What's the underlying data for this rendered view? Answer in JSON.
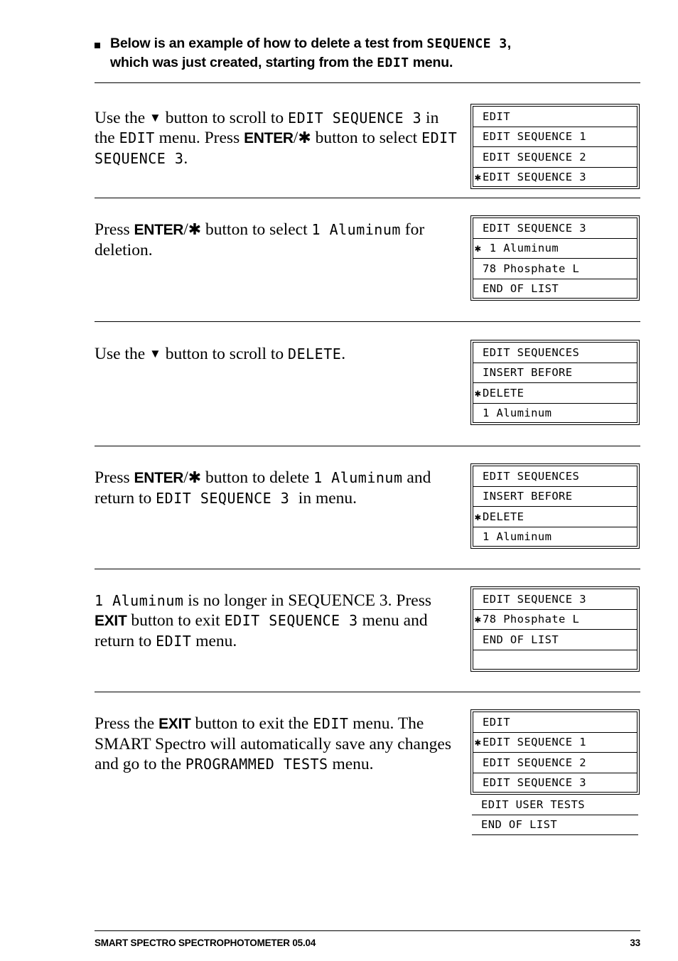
{
  "header": {
    "bullet": "square-bullet",
    "line1_a": "Below is an example of how to delete a test from ",
    "line1_mono": "SEQUENCE 3",
    "line1_b": ",",
    "line2_a": "which was just created, starting from the ",
    "line2_mono": "EDIT",
    "line2_b": " menu."
  },
  "steps": [
    {
      "id": "step-1",
      "text_runs": [
        {
          "t": "Use the ",
          "s": "plain"
        },
        {
          "t": "▼",
          "s": "arrow"
        },
        {
          "t": " button to scroll to ",
          "s": "plain"
        },
        {
          "t": "EDIT SEQUENCE 3",
          "s": "mono"
        },
        {
          "t": " in the ",
          "s": "plain"
        },
        {
          "t": "EDIT",
          "s": "mono"
        },
        {
          "t": " menu. Press ",
          "s": "plain"
        },
        {
          "t": "ENTER",
          "s": "btn"
        },
        {
          "t": "/",
          "s": "plain"
        },
        {
          "t": "✱",
          "s": "ast"
        },
        {
          "t": " button to select ",
          "s": "plain"
        },
        {
          "t": "EDIT SEQUENCE 3",
          "s": "mono"
        },
        {
          "t": ".",
          "s": "plain"
        }
      ],
      "lcd": {
        "rows": [
          {
            "marker": "",
            "label": "EDIT"
          },
          {
            "marker": "",
            "label": "EDIT SEQUENCE 1"
          },
          {
            "marker": "",
            "label": "EDIT SEQUENCE 2"
          },
          {
            "marker": "✱",
            "label": "EDIT SEQUENCE 3"
          }
        ],
        "overflow_rows": []
      }
    },
    {
      "id": "step-2",
      "text_runs": [
        {
          "t": "Press ",
          "s": "plain"
        },
        {
          "t": "ENTER",
          "s": "btn"
        },
        {
          "t": "/",
          "s": "plain"
        },
        {
          "t": "✱",
          "s": "ast"
        },
        {
          "t": " button to select ",
          "s": "plain"
        },
        {
          "t": "1 Aluminum",
          "s": "mono"
        },
        {
          "t": " for deletion.",
          "s": "plain"
        }
      ],
      "lcd": {
        "rows": [
          {
            "marker": "",
            "label": "EDIT SEQUENCE 3"
          },
          {
            "marker": "✱",
            "label": " 1 Aluminum"
          },
          {
            "marker": "",
            "label": "78 Phosphate L"
          },
          {
            "marker": "",
            "label": "END OF LIST"
          }
        ],
        "overflow_rows": []
      }
    },
    {
      "id": "step-3",
      "text_runs": [
        {
          "t": "Use the ",
          "s": "plain"
        },
        {
          "t": "▼",
          "s": "arrow"
        },
        {
          "t": " button to scroll to ",
          "s": "plain"
        },
        {
          "t": "DELETE",
          "s": "mono"
        },
        {
          "t": ".",
          "s": "plain"
        }
      ],
      "lcd": {
        "rows": [
          {
            "marker": "",
            "label": "EDIT SEQUENCES"
          },
          {
            "marker": "",
            "label": "INSERT BEFORE"
          },
          {
            "marker": "✱",
            "label": "DELETE"
          },
          {
            "marker": "",
            "label": "1 Aluminum"
          }
        ],
        "overflow_rows": []
      }
    },
    {
      "id": "step-4",
      "text_runs": [
        {
          "t": "Press ",
          "s": "plain"
        },
        {
          "t": "ENTER",
          "s": "btn"
        },
        {
          "t": "/",
          "s": "plain"
        },
        {
          "t": "✱",
          "s": "ast"
        },
        {
          "t": " button to delete ",
          "s": "plain"
        },
        {
          "t": "1 Aluminum",
          "s": "mono"
        },
        {
          "t": " and return to ",
          "s": "plain"
        },
        {
          "t": " EDIT SEQUENCE 3 ",
          "s": "mono"
        },
        {
          "t": " in menu.",
          "s": "plain"
        }
      ],
      "lcd": {
        "rows": [
          {
            "marker": "",
            "label": "EDIT SEQUENCES"
          },
          {
            "marker": "",
            "label": "INSERT BEFORE"
          },
          {
            "marker": "✱",
            "label": "DELETE"
          },
          {
            "marker": "",
            "label": "1 Aluminum"
          }
        ],
        "overflow_rows": []
      }
    },
    {
      "id": "step-5",
      "text_runs": [
        {
          "t": "1 Aluminum",
          "s": "mono"
        },
        {
          "t": " is no longer in SEQUENCE 3. Press ",
          "s": "plain"
        },
        {
          "t": "EXIT",
          "s": "btn"
        },
        {
          "t": " button to exit ",
          "s": "plain"
        },
        {
          "t": "EDIT SEQUENCE 3",
          "s": "mono"
        },
        {
          "t": " menu and return to ",
          "s": "plain"
        },
        {
          "t": "EDIT",
          "s": "mono"
        },
        {
          "t": " menu.",
          "s": "plain"
        }
      ],
      "lcd": {
        "rows": [
          {
            "marker": "",
            "label": "EDIT SEQUENCE 3"
          },
          {
            "marker": "✱",
            "label": "78 Phosphate L"
          },
          {
            "marker": "",
            "label": "END OF LIST"
          },
          {
            "marker": "",
            "label": ""
          }
        ],
        "overflow_rows": []
      }
    },
    {
      "id": "step-6",
      "text_runs": [
        {
          "t": "Press the ",
          "s": "plain"
        },
        {
          "t": "EXIT",
          "s": "btn"
        },
        {
          "t": " button to exit the ",
          "s": "plain"
        },
        {
          "t": "EDIT",
          "s": "mono"
        },
        {
          "t": " menu. The SMART Spectro will automatically save any changes and go to the ",
          "s": "plain"
        },
        {
          "t": "PROGRAMMED TESTS",
          "s": "mono"
        },
        {
          "t": " menu.",
          "s": "plain"
        }
      ],
      "lcd": {
        "rows": [
          {
            "marker": "",
            "label": "EDIT"
          },
          {
            "marker": "✱",
            "label": "EDIT SEQUENCE 1"
          },
          {
            "marker": "",
            "label": "EDIT SEQUENCE 2"
          },
          {
            "marker": "",
            "label": "EDIT SEQUENCE 3"
          }
        ],
        "overflow_rows": [
          {
            "marker": "",
            "label": "EDIT USER TESTS"
          },
          {
            "marker": "",
            "label": "END OF LIST"
          }
        ]
      }
    }
  ],
  "footer": {
    "left": "SMART SPECTRO SPECTROPHOTOMETER  05.04",
    "page_number": "33"
  }
}
